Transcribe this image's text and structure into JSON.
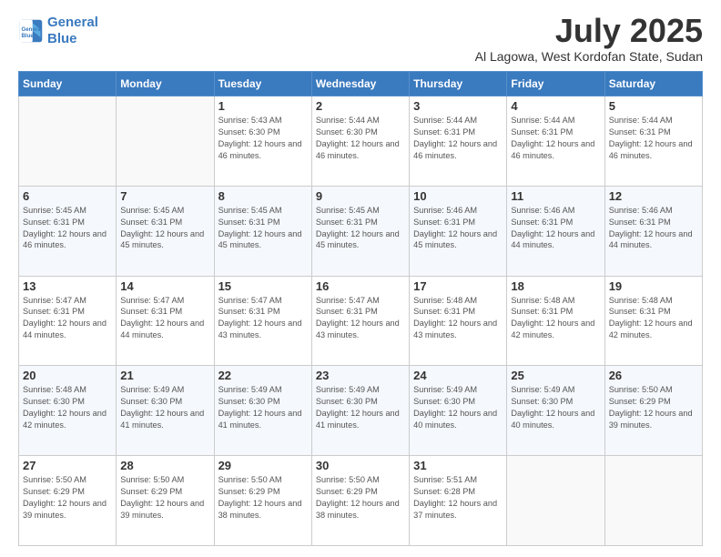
{
  "header": {
    "logo_line1": "General",
    "logo_line2": "Blue",
    "title": "July 2025",
    "location": "Al Lagowa, West Kordofan State, Sudan"
  },
  "days_of_week": [
    "Sunday",
    "Monday",
    "Tuesday",
    "Wednesday",
    "Thursday",
    "Friday",
    "Saturday"
  ],
  "weeks": [
    [
      {
        "day": "",
        "info": ""
      },
      {
        "day": "",
        "info": ""
      },
      {
        "day": "1",
        "info": "Sunrise: 5:43 AM\nSunset: 6:30 PM\nDaylight: 12 hours and 46 minutes."
      },
      {
        "day": "2",
        "info": "Sunrise: 5:44 AM\nSunset: 6:30 PM\nDaylight: 12 hours and 46 minutes."
      },
      {
        "day": "3",
        "info": "Sunrise: 5:44 AM\nSunset: 6:31 PM\nDaylight: 12 hours and 46 minutes."
      },
      {
        "day": "4",
        "info": "Sunrise: 5:44 AM\nSunset: 6:31 PM\nDaylight: 12 hours and 46 minutes."
      },
      {
        "day": "5",
        "info": "Sunrise: 5:44 AM\nSunset: 6:31 PM\nDaylight: 12 hours and 46 minutes."
      }
    ],
    [
      {
        "day": "6",
        "info": "Sunrise: 5:45 AM\nSunset: 6:31 PM\nDaylight: 12 hours and 46 minutes."
      },
      {
        "day": "7",
        "info": "Sunrise: 5:45 AM\nSunset: 6:31 PM\nDaylight: 12 hours and 45 minutes."
      },
      {
        "day": "8",
        "info": "Sunrise: 5:45 AM\nSunset: 6:31 PM\nDaylight: 12 hours and 45 minutes."
      },
      {
        "day": "9",
        "info": "Sunrise: 5:45 AM\nSunset: 6:31 PM\nDaylight: 12 hours and 45 minutes."
      },
      {
        "day": "10",
        "info": "Sunrise: 5:46 AM\nSunset: 6:31 PM\nDaylight: 12 hours and 45 minutes."
      },
      {
        "day": "11",
        "info": "Sunrise: 5:46 AM\nSunset: 6:31 PM\nDaylight: 12 hours and 44 minutes."
      },
      {
        "day": "12",
        "info": "Sunrise: 5:46 AM\nSunset: 6:31 PM\nDaylight: 12 hours and 44 minutes."
      }
    ],
    [
      {
        "day": "13",
        "info": "Sunrise: 5:47 AM\nSunset: 6:31 PM\nDaylight: 12 hours and 44 minutes."
      },
      {
        "day": "14",
        "info": "Sunrise: 5:47 AM\nSunset: 6:31 PM\nDaylight: 12 hours and 44 minutes."
      },
      {
        "day": "15",
        "info": "Sunrise: 5:47 AM\nSunset: 6:31 PM\nDaylight: 12 hours and 43 minutes."
      },
      {
        "day": "16",
        "info": "Sunrise: 5:47 AM\nSunset: 6:31 PM\nDaylight: 12 hours and 43 minutes."
      },
      {
        "day": "17",
        "info": "Sunrise: 5:48 AM\nSunset: 6:31 PM\nDaylight: 12 hours and 43 minutes."
      },
      {
        "day": "18",
        "info": "Sunrise: 5:48 AM\nSunset: 6:31 PM\nDaylight: 12 hours and 42 minutes."
      },
      {
        "day": "19",
        "info": "Sunrise: 5:48 AM\nSunset: 6:31 PM\nDaylight: 12 hours and 42 minutes."
      }
    ],
    [
      {
        "day": "20",
        "info": "Sunrise: 5:48 AM\nSunset: 6:30 PM\nDaylight: 12 hours and 42 minutes."
      },
      {
        "day": "21",
        "info": "Sunrise: 5:49 AM\nSunset: 6:30 PM\nDaylight: 12 hours and 41 minutes."
      },
      {
        "day": "22",
        "info": "Sunrise: 5:49 AM\nSunset: 6:30 PM\nDaylight: 12 hours and 41 minutes."
      },
      {
        "day": "23",
        "info": "Sunrise: 5:49 AM\nSunset: 6:30 PM\nDaylight: 12 hours and 41 minutes."
      },
      {
        "day": "24",
        "info": "Sunrise: 5:49 AM\nSunset: 6:30 PM\nDaylight: 12 hours and 40 minutes."
      },
      {
        "day": "25",
        "info": "Sunrise: 5:49 AM\nSunset: 6:30 PM\nDaylight: 12 hours and 40 minutes."
      },
      {
        "day": "26",
        "info": "Sunrise: 5:50 AM\nSunset: 6:29 PM\nDaylight: 12 hours and 39 minutes."
      }
    ],
    [
      {
        "day": "27",
        "info": "Sunrise: 5:50 AM\nSunset: 6:29 PM\nDaylight: 12 hours and 39 minutes."
      },
      {
        "day": "28",
        "info": "Sunrise: 5:50 AM\nSunset: 6:29 PM\nDaylight: 12 hours and 39 minutes."
      },
      {
        "day": "29",
        "info": "Sunrise: 5:50 AM\nSunset: 6:29 PM\nDaylight: 12 hours and 38 minutes."
      },
      {
        "day": "30",
        "info": "Sunrise: 5:50 AM\nSunset: 6:29 PM\nDaylight: 12 hours and 38 minutes."
      },
      {
        "day": "31",
        "info": "Sunrise: 5:51 AM\nSunset: 6:28 PM\nDaylight: 12 hours and 37 minutes."
      },
      {
        "day": "",
        "info": ""
      },
      {
        "day": "",
        "info": ""
      }
    ]
  ]
}
